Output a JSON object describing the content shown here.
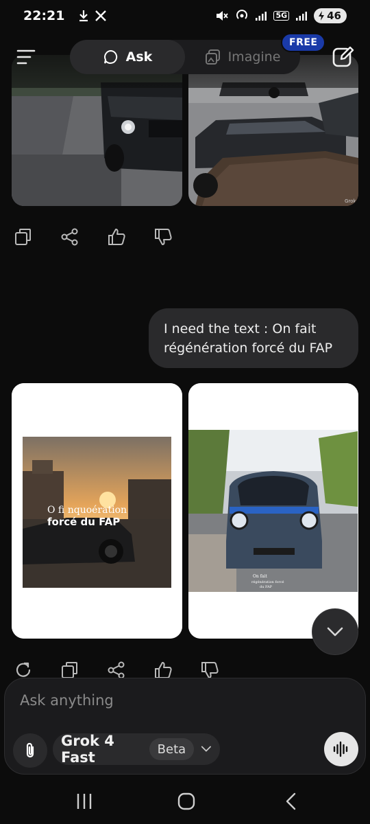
{
  "status_bar": {
    "time": "22:21",
    "battery_level": "46",
    "network": "5G"
  },
  "header": {
    "tabs": [
      {
        "label": "Ask",
        "active": true,
        "icon": "chat-bubble-icon"
      },
      {
        "label": "Imagine",
        "active": false,
        "icon": "image-stack-icon"
      }
    ],
    "free_badge": "FREE"
  },
  "conversation": {
    "user_message": "I need the text : On fait régénération forcé du FAP",
    "user_message_lines": [
      "I need the text : On fait",
      "régénération forcé du FAP"
    ],
    "image_watermark": "Grok",
    "generated_image_1_overlay": [
      "O fi nquoération",
      "forcé du FAP"
    ],
    "generated_image_2_overlay": [
      "On fait",
      "régénération forcé",
      "du FAP"
    ]
  },
  "composer": {
    "placeholder": "Ask anything",
    "model_name": "Grok 4 Fast",
    "model_badge": "Beta"
  },
  "colors": {
    "background": "#0c0c0c",
    "bubble": "#2a2a2c",
    "free_badge": "#1a3aa8",
    "accent_light": "#e6e6e6"
  }
}
